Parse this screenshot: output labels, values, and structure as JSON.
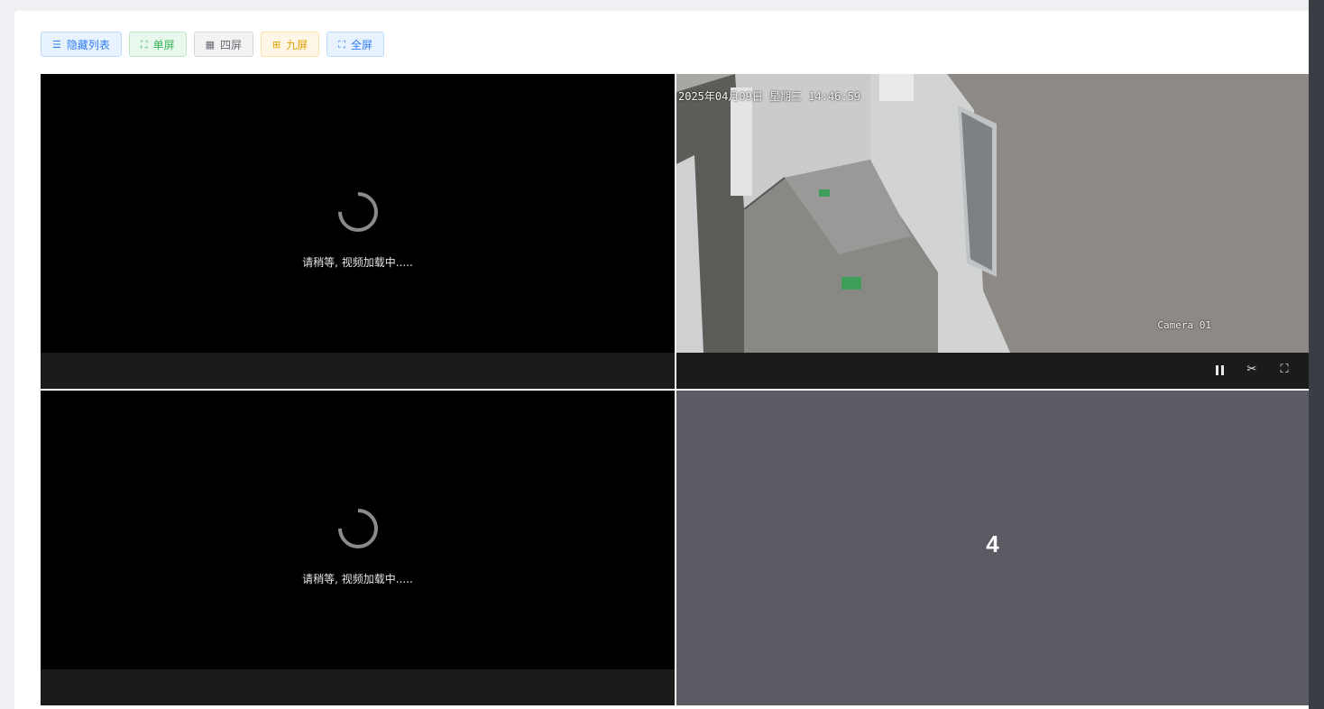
{
  "toolbar": {
    "buttons": [
      {
        "label": "隐藏列表",
        "icon": "list-icon",
        "style": "blue"
      },
      {
        "label": "单屏",
        "icon": "single-screen-icon",
        "style": "green"
      },
      {
        "label": "四屏",
        "icon": "four-screen-icon",
        "style": "gray"
      },
      {
        "label": "九屏",
        "icon": "nine-screen-icon",
        "style": "yellow"
      },
      {
        "label": "全屏",
        "icon": "fullscreen-icon",
        "style": "blue"
      }
    ]
  },
  "players": [
    {
      "slot": 1,
      "state": "loading",
      "loading_text": "请稍等, 视频加载中....."
    },
    {
      "slot": 2,
      "state": "playing",
      "osd_timestamp": "2025年04月09日 星期三 14:46:59",
      "camera_label": "Camera 01",
      "controls": [
        {
          "name": "pause-icon"
        },
        {
          "name": "screenshot-icon"
        },
        {
          "name": "fullscreen-icon"
        }
      ]
    },
    {
      "slot": 3,
      "state": "loading",
      "loading_text": "请稍等, 视频加载中....."
    },
    {
      "slot": 4,
      "state": "empty",
      "slot_label": "4"
    }
  ],
  "colors": {
    "accent_blue": "#2f7cf6",
    "accent_green": "#37b55a",
    "accent_yellow": "#e0a000",
    "empty_slot": "#5a5b63",
    "control_bar": "#1b1b1c"
  }
}
